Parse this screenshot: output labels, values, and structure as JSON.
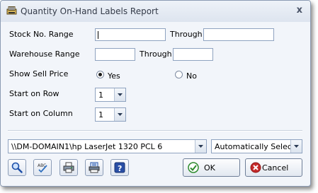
{
  "window": {
    "title": "Quantity On-Hand Labels Report",
    "close_glyph": "x"
  },
  "stock": {
    "label": "Stock No. Range",
    "through_label": "Through",
    "from_value": "",
    "to_value": ""
  },
  "warehouse": {
    "label": "Warehouse Range",
    "through_label": "Through",
    "from_value": "",
    "to_value": ""
  },
  "sell_price": {
    "label": "Show Sell Price",
    "options": [
      "Yes",
      "No"
    ],
    "selected": "Yes"
  },
  "start_row": {
    "label": "Start on Row",
    "value": "1"
  },
  "start_column": {
    "label": "Start on Column",
    "value": "1"
  },
  "printer": {
    "name": "\\\\DM-DOMAIN1\\hp LaserJet 1320 PCL 6",
    "selection": "Automatically Select"
  },
  "toolbar": {
    "icons": [
      "magnifier-preview-icon",
      "spell-check-icon",
      "printer-setup-icon",
      "print-icon",
      "help-icon"
    ]
  },
  "buttons": {
    "ok": "OK",
    "cancel": "Cancel"
  },
  "colors": {
    "title_text": "#333a48",
    "window_bg": "#f2f5fa",
    "border": "#8b9bb3",
    "ok_check": "#2e8b2e",
    "cancel_x": "#c42a2a",
    "help_blue": "#2a4fa6"
  }
}
